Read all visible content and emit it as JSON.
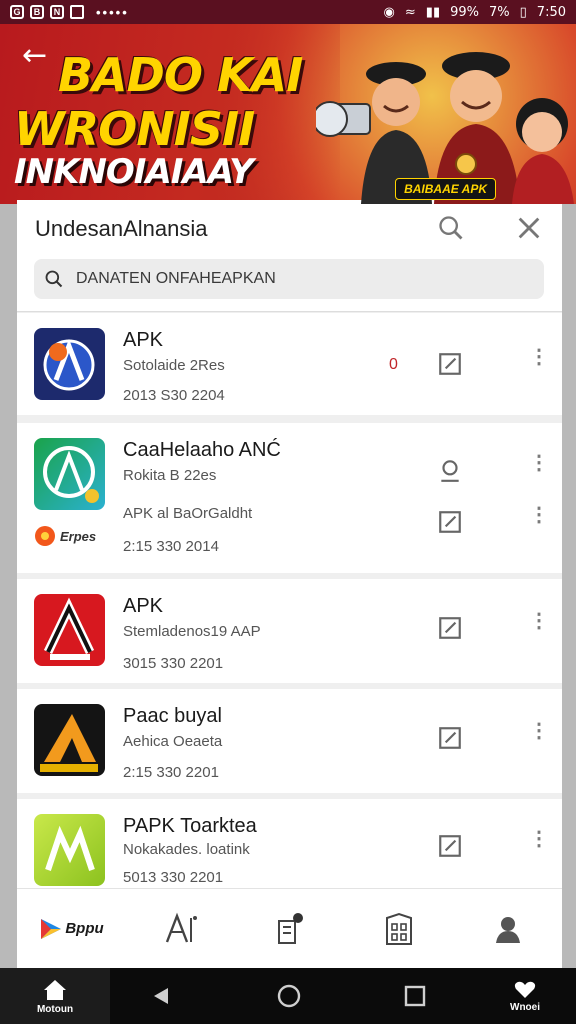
{
  "status_bar": {
    "left_icons": [
      "G",
      "B",
      "N"
    ],
    "dots": "•••••",
    "battery_percent": "99%",
    "second_percent": "7%",
    "time": "7:50"
  },
  "banner": {
    "line1": "BADO KAI",
    "line2": "WRONISII",
    "line3": "INKNOIAIAAY",
    "badge": "BAIBAAE APK"
  },
  "header": {
    "title": "UndesanAlnansia"
  },
  "search": {
    "placeholder": "DANATEN ONFAHEAPKAN"
  },
  "apps": [
    {
      "name": "APK",
      "subtitle": "Sotolaide 2Res",
      "date": "2013 S30 2204",
      "count": "0",
      "icon_bg": "#1d2a6d"
    },
    {
      "name": "CaaHelaaho ANĆ",
      "subtitle": "Rokita B 22es",
      "subtitle2": "APK al BaOrGaldht",
      "date": "2:15 330 2014",
      "mini_logo": "Erpes",
      "icon_bg": "#1aa34a"
    },
    {
      "name": "APK",
      "subtitle": "Stemladenos19 AAP",
      "date": "3015 330 2201",
      "icon_bg": "#d7181f"
    },
    {
      "name": "Paac buyal",
      "subtitle": "Aehica Oeaeta",
      "date": "2:15 330 2201",
      "icon_bg": "#141414"
    },
    {
      "name": "PAPK Toarktea",
      "subtitle": "Nokakades. loatink",
      "date": "5013 330 2201",
      "icon_bg": "#a5d12f"
    }
  ],
  "tabs": {
    "brand_label": "Bppu"
  },
  "navbar": {
    "home_label": "Motoun",
    "right_label": "Wnoei"
  }
}
